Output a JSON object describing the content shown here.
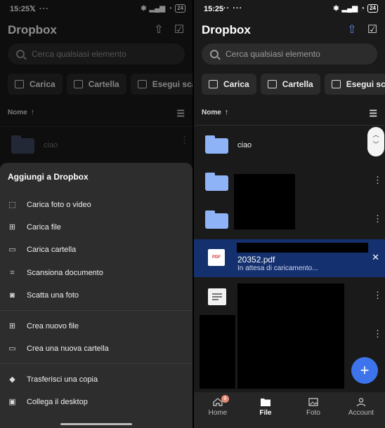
{
  "status_bar": {
    "left": {
      "time": "15:25",
      "extra": "𝕏 ···"
    },
    "right": {
      "time": "15:25",
      "extra": "·· ···"
    },
    "battery": "24"
  },
  "app": {
    "title": "Dropbox"
  },
  "search": {
    "placeholder": "Cerca qualsiasi elemento"
  },
  "actions": [
    {
      "label": "Carica",
      "icon": "upload-image-icon"
    },
    {
      "label": "Cartella",
      "icon": "folder-add-icon"
    },
    {
      "label": "Esegui scansione",
      "icon": "scan-icon"
    }
  ],
  "sort": {
    "label": "Nome",
    "direction": "ascending"
  },
  "files": [
    {
      "name": "ciao",
      "type": "folder"
    },
    {
      "name": "",
      "type": "folder"
    },
    {
      "name": "",
      "type": "folder"
    }
  ],
  "upload": {
    "filename": "20352.pdf",
    "status": "In attesa di caricamento...",
    "icon_text": "PDF"
  },
  "sheet": {
    "title": "Aggiungi a Dropbox",
    "groups": [
      [
        {
          "label": "Carica foto o video",
          "icon": "photo-upload-icon"
        },
        {
          "label": "Carica file",
          "icon": "file-upload-icon"
        },
        {
          "label": "Carica cartella",
          "icon": "folder-upload-icon"
        },
        {
          "label": "Scansiona documento",
          "icon": "scan-document-icon"
        },
        {
          "label": "Scatta una foto",
          "icon": "camera-icon"
        }
      ],
      [
        {
          "label": "Crea nuovo file",
          "icon": "new-file-icon"
        },
        {
          "label": "Crea una nuova cartella",
          "icon": "new-folder-icon"
        }
      ],
      [
        {
          "label": "Trasferisci una copia",
          "icon": "transfer-icon"
        },
        {
          "label": "Collega il desktop",
          "icon": "desktop-icon"
        }
      ]
    ]
  },
  "nav": {
    "items": [
      {
        "label": "Home",
        "icon": "home-icon",
        "badge": "8"
      },
      {
        "label": "File",
        "icon": "folder-icon",
        "active": true
      },
      {
        "label": "Foto",
        "icon": "photo-icon"
      },
      {
        "label": "Account",
        "icon": "account-icon"
      }
    ]
  },
  "colors": {
    "accent": "#3d74ec",
    "folder": "#8fb3f7",
    "upload_bg": "#14306e",
    "badge": "#e58a72"
  }
}
